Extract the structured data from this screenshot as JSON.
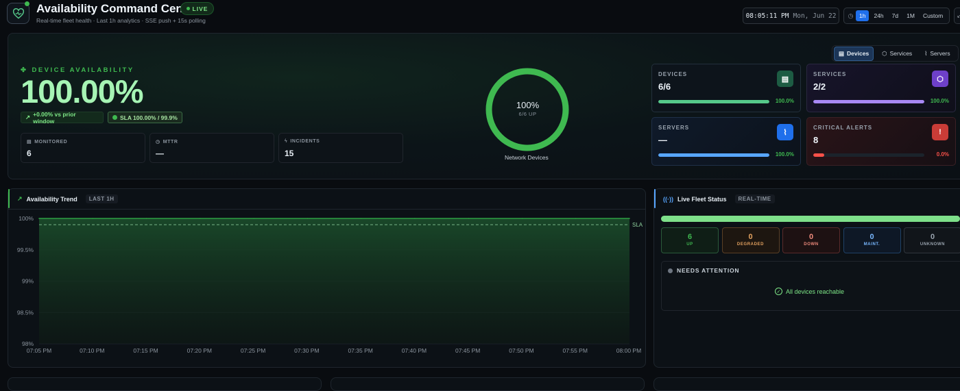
{
  "header": {
    "title": "Availability Command Center",
    "subtitle": "Real-time fleet health · Last 1h analytics · SSE push + 15s polling",
    "live_badge": "LIVE",
    "time": "08:05:11 PM",
    "date": "Mon, Jun 22",
    "ranges": [
      "1h",
      "24h",
      "7d",
      "1M",
      "Custom"
    ],
    "active_range": "1h"
  },
  "view_tabs": [
    {
      "label": "Devices",
      "active": true
    },
    {
      "label": "Services",
      "active": false
    },
    {
      "label": "Servers",
      "active": false
    }
  ],
  "hero": {
    "label": "DEVICE AVAILABILITY",
    "value": "100.00%",
    "delta_chip": "+0.00% vs prior window",
    "sla_chip": "SLA 100.00% / 99.9%",
    "stats": [
      {
        "label": "MONITORED",
        "value": "6"
      },
      {
        "label": "MTTR",
        "value": "—"
      },
      {
        "label": "INCIDENTS",
        "value": "15"
      }
    ],
    "ring": {
      "percent": "100%",
      "sub": "6/6 UP",
      "caption": "Network Devices",
      "fraction": 1.0
    }
  },
  "cards": [
    {
      "label": "DEVICES",
      "value": "6/6",
      "pct": "100.0%",
      "fill": 1.0,
      "color": "#3fb950",
      "bar": "#56c98a",
      "icon_bg": "#1d5c43",
      "pct_color": "#3fb950"
    },
    {
      "label": "SERVICES",
      "value": "2/2",
      "pct": "100.0%",
      "fill": 1.0,
      "color": "#a371f7",
      "bar": "#a888f5",
      "icon_bg": "#6e40c9",
      "pct_color": "#3fb950"
    },
    {
      "label": "SERVERS",
      "value": "—",
      "pct": "100.0%",
      "fill": 1.0,
      "color": "#58a6ff",
      "bar": "#58a6ff",
      "icon_bg": "#1f6feb",
      "pct_color": "#3fb950"
    },
    {
      "label": "CRITICAL ALERTS",
      "value": "8",
      "pct": "0.0%",
      "fill": 0.1,
      "color": "#f85149",
      "bar": "#f85149",
      "icon_bg": "#c93c37",
      "pct_color": "#f85149"
    }
  ],
  "trend": {
    "title": "Availability Trend",
    "tag": "LAST 1H",
    "sla_label": "SLA"
  },
  "chart_data": {
    "type": "area",
    "x": [
      "07:05 PM",
      "07:10 PM",
      "07:15 PM",
      "07:20 PM",
      "07:25 PM",
      "07:30 PM",
      "07:35 PM",
      "07:40 PM",
      "07:45 PM",
      "07:50 PM",
      "07:55 PM",
      "08:00 PM"
    ],
    "series": [
      {
        "values": [
          100,
          100,
          100,
          100,
          100,
          100,
          100,
          100,
          100,
          100,
          100,
          100
        ]
      }
    ],
    "y_ticks": [
      "100%",
      "99.5%",
      "99%",
      "98.5%",
      "98%"
    ],
    "ylim": [
      98,
      100
    ],
    "sla": 99.9,
    "grid": true
  },
  "fleet": {
    "title": "Live Fleet Status",
    "tag": "REAL-TIME",
    "counts": [
      {
        "value": "6",
        "label": "UP",
        "color": "#3fb950",
        "border": "#2a5a3a",
        "bg": "#0f1e16"
      },
      {
        "value": "0",
        "label": "DEGRADED",
        "color": "#e3a15f",
        "border": "#5a3f25",
        "bg": "#1d1610"
      },
      {
        "value": "0",
        "label": "DOWN",
        "color": "#f08b7d",
        "border": "#5a2a2a",
        "bg": "#1d1112"
      },
      {
        "value": "0",
        "label": "MAINT.",
        "color": "#79b8ff",
        "border": "#1f4166",
        "bg": "#0e1826"
      },
      {
        "value": "0",
        "label": "UNKNOWN",
        "color": "#9aa4af",
        "border": "#30363d",
        "bg": "#11151a"
      }
    ],
    "attention_title": "NEEDS ATTENTION",
    "attention_msg": "All devices reachable"
  }
}
